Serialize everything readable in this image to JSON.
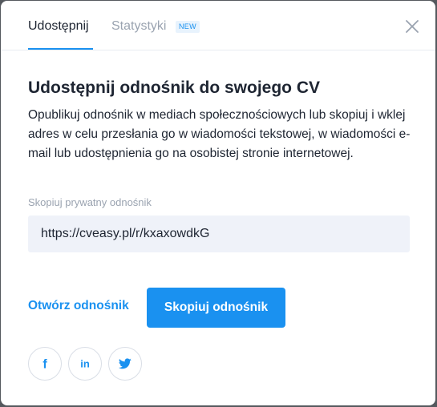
{
  "tabs": {
    "share_label": "Udostępnij",
    "stats_label": "Statystyki",
    "stats_badge": "NEW"
  },
  "content": {
    "heading": "Udostępnij odnośnik do swojego CV",
    "description": "Opublikuj odnośnik w mediach społecznościowych lub skopiuj i wklej adres w celu przesłania go w wiadomości tekstowej, w wiadomości e-mail lub udostępnienia go na osobistej stronie internetowej.",
    "field_label": "Skopiuj prywatny odnośnik",
    "link_value": "https://cveasy.pl/r/kxaxowdkG"
  },
  "actions": {
    "open_link_label": "Otwórz odnośnik",
    "copy_link_label": "Skopiuj odnośnik"
  },
  "social": {
    "icons": [
      "facebook-icon",
      "linkedin-icon",
      "twitter-icon"
    ],
    "facebook_glyph": "f",
    "linkedin_glyph": "in"
  },
  "colors": {
    "accent": "#1a91f0",
    "text": "#1e2532",
    "muted": "#9aa3b0",
    "field_bg": "#eff2f9",
    "badge_bg": "#e8f3fd"
  }
}
